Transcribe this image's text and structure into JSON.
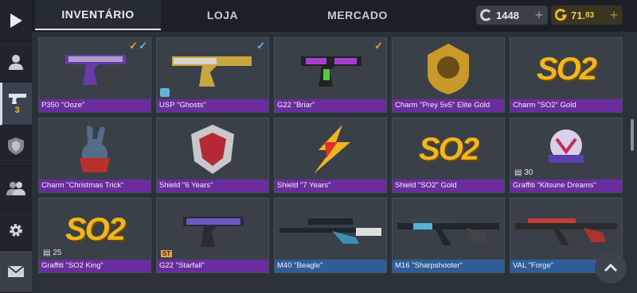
{
  "sidebar": {
    "items": [
      {
        "icon": "play-icon"
      },
      {
        "icon": "profile-icon"
      },
      {
        "icon": "pistol-icon",
        "count": "3"
      },
      {
        "icon": "rank-shield-icon"
      },
      {
        "icon": "friends-icon"
      },
      {
        "icon": "gear-icon"
      },
      {
        "icon": "mail-icon"
      }
    ]
  },
  "tabs": [
    "INVENTÁRIO",
    "LOJA",
    "MERCADO"
  ],
  "currency": {
    "silver": "1448",
    "gold_main": "71.",
    "gold_cents": "83"
  },
  "items": [
    {
      "name": "P350 \"Ooze\"",
      "rarity": "purple",
      "checks": [
        "gold",
        "blue"
      ]
    },
    {
      "name": "USP \"Ghosts\"",
      "rarity": "purple",
      "checks": [
        "blue"
      ],
      "badge": true
    },
    {
      "name": "G22 \"Briar\"",
      "rarity": "purple",
      "checks": [
        "gold"
      ]
    },
    {
      "name": "Charm \"Prey 5v5\" Elite Gold",
      "rarity": "purple"
    },
    {
      "name": "Charm \"SO2\" Gold",
      "rarity": "purple",
      "art_text": "SO2"
    },
    {
      "name": "Charm \"Christmas Trick\"",
      "rarity": "purple"
    },
    {
      "name": "Shield \"6 Years\"",
      "rarity": "purple"
    },
    {
      "name": "Shield \"7 Years\"",
      "rarity": "purple"
    },
    {
      "name": "Shield \"SO2\" Gold",
      "rarity": "purple",
      "art_text": "SO2"
    },
    {
      "name": "Graffiti \"Kitsune Dreams\"",
      "rarity": "purple",
      "qty": "30"
    },
    {
      "name": "Graffiti \"SO2 King\"",
      "rarity": "purple",
      "qty": "25",
      "art_text": "SO2"
    },
    {
      "name": "G22 \"Starfall\"",
      "rarity": "purple",
      "st": "ST"
    },
    {
      "name": "M40 \"Beagle\"",
      "rarity": "blue"
    },
    {
      "name": "M16 \"Sharpshooter\"",
      "rarity": "blue"
    },
    {
      "name": "VAL \"Forge\"",
      "rarity": "blue"
    }
  ]
}
